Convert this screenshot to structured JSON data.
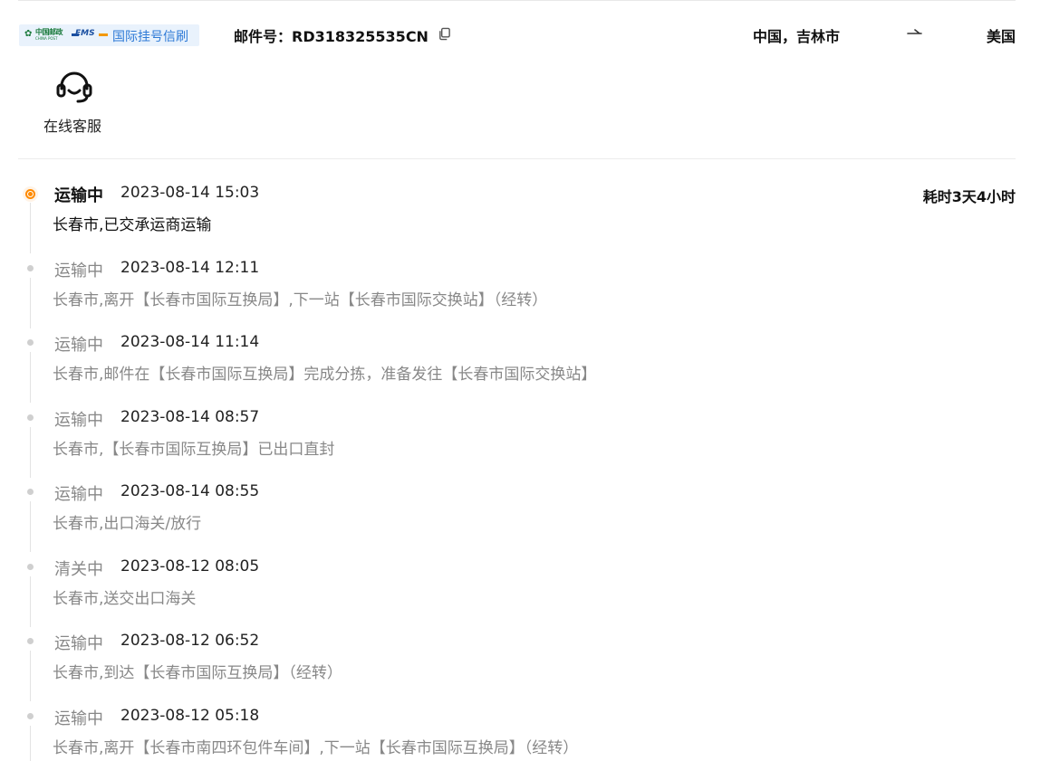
{
  "header": {
    "badge_label": "国际挂号信刷",
    "tracking_prefix": "邮件号：",
    "tracking_number": "RD318325535CN",
    "origin": "中国，吉林市",
    "destination": "美国",
    "logo_chinapost_cn": "中国邮政",
    "logo_chinapost_en": "CHINA POST",
    "logo_ems": "EMS"
  },
  "service": {
    "label": "在线客服",
    "icon": "headset-icon"
  },
  "colors": {
    "accent": "#ff8a00",
    "badge_bg": "#e9f2fc",
    "badge_text": "#2e7ad6",
    "muted": "#888888"
  },
  "summary": {
    "duration": "耗时3天4小时"
  },
  "events": [
    {
      "status": "运输中",
      "time": "2023-08-14 15:03",
      "desc": "长春市,已交承运商运输",
      "current": true
    },
    {
      "status": "运输中",
      "time": "2023-08-14 12:11",
      "desc": "长春市,离开【长春市国际互换局】,下一站【长春市国际交换站】（经转）",
      "current": false
    },
    {
      "status": "运输中",
      "time": "2023-08-14 11:14",
      "desc": "长春市,邮件在【长春市国际互换局】完成分拣，准备发往【长春市国际交换站】",
      "current": false
    },
    {
      "status": "运输中",
      "time": "2023-08-14 08:57",
      "desc": "长春市,【长春市国际互换局】已出口直封",
      "current": false
    },
    {
      "status": "运输中",
      "time": "2023-08-14 08:55",
      "desc": "长春市,出口海关/放行",
      "current": false
    },
    {
      "status": "清关中",
      "time": "2023-08-12 08:05",
      "desc": "长春市,送交出口海关",
      "current": false
    },
    {
      "status": "运输中",
      "time": "2023-08-12 06:52",
      "desc": "长春市,到达【长春市国际互换局】（经转）",
      "current": false
    },
    {
      "status": "运输中",
      "time": "2023-08-12 05:18",
      "desc": "长春市,离开【长春市南四环包件车间】,下一站【长春市国际互换局】（经转）",
      "current": false
    }
  ]
}
